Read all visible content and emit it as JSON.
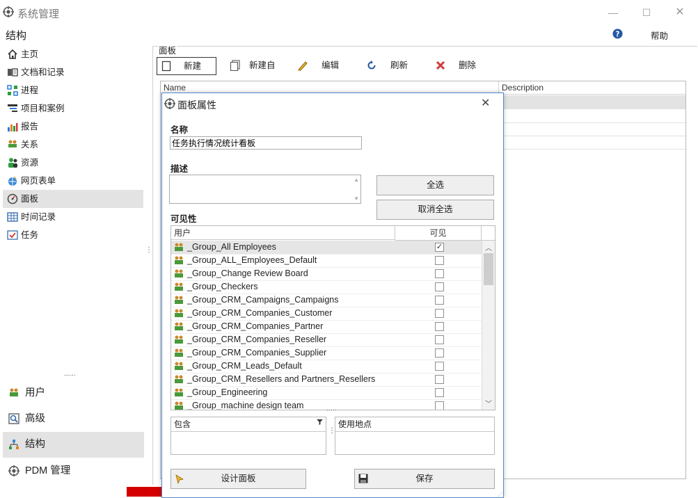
{
  "window": {
    "title": "系统管理",
    "help_label": "帮助"
  },
  "sidebar": {
    "title": "结构",
    "items": [
      {
        "label": "主页",
        "icon": "home-icon"
      },
      {
        "label": "文档和记录",
        "icon": "documents-icon"
      },
      {
        "label": "进程",
        "icon": "process-icon"
      },
      {
        "label": "项目和案例",
        "icon": "projects-icon"
      },
      {
        "label": "报告",
        "icon": "report-chart-icon"
      },
      {
        "label": "关系",
        "icon": "relations-icon"
      },
      {
        "label": "资源",
        "icon": "resources-icon"
      },
      {
        "label": "网页表单",
        "icon": "web-form-icon"
      },
      {
        "label": "面板",
        "icon": "dashboard-icon"
      },
      {
        "label": "时间记录",
        "icon": "time-record-icon"
      },
      {
        "label": "任务",
        "icon": "task-icon"
      }
    ],
    "selected_index": 8,
    "splitter_dots": "......",
    "bottom": [
      {
        "label": "用户",
        "icon": "users-icon"
      },
      {
        "label": "高级",
        "icon": "advanced-icon"
      },
      {
        "label": "结构",
        "icon": "structure-icon"
      },
      {
        "label": "PDM 管理",
        "icon": "pdm-icon"
      }
    ]
  },
  "main": {
    "section_title": "面板",
    "toolbar": [
      {
        "label": "新建",
        "icon": "new-icon"
      },
      {
        "label": "新建自",
        "icon": "copy-icon"
      },
      {
        "label": "编辑",
        "icon": "pencil-icon"
      },
      {
        "label": "刷新",
        "icon": "refresh-icon"
      },
      {
        "label": "删除",
        "icon": "delete-icon"
      }
    ],
    "grid": {
      "columns": [
        "Name",
        "Description"
      ]
    }
  },
  "dialog": {
    "title": "面板属性",
    "name_label": "名称",
    "name_value": "任务执行情况统计看板",
    "description_label": "描述",
    "description_value": "",
    "select_all": "全选",
    "deselect_all": "取消全选",
    "visibility_label": "可见性",
    "columns": [
      "用户",
      "可见"
    ],
    "users": [
      {
        "name": "_Group_All Employees",
        "visible": true
      },
      {
        "name": "_Group_ALL_Employees_Default",
        "visible": false
      },
      {
        "name": "_Group_Change Review Board",
        "visible": false
      },
      {
        "name": "_Group_Checkers",
        "visible": false
      },
      {
        "name": "_Group_CRM_Campaigns_Campaigns",
        "visible": false
      },
      {
        "name": "_Group_CRM_Companies_Customer",
        "visible": false
      },
      {
        "name": "_Group_CRM_Companies_Partner",
        "visible": false
      },
      {
        "name": "_Group_CRM_Companies_Reseller",
        "visible": false
      },
      {
        "name": "_Group_CRM_Companies_Supplier",
        "visible": false
      },
      {
        "name": "_Group_CRM_Leads_Default",
        "visible": false
      },
      {
        "name": "_Group_CRM_Resellers and Partners_Resellers",
        "visible": false
      },
      {
        "name": "_Group_Engineering",
        "visible": false
      },
      {
        "name": "_Group_machine design team",
        "visible": false
      }
    ],
    "contains_label": "包含",
    "used_in_label": "使用地点",
    "design_button": "设计面板",
    "save_button": "保存",
    "check_mark": "✓"
  },
  "colors": {
    "accent_border": "#4f8bd0",
    "selected_bg": "#e3e3e3",
    "red_strip": "#d40000"
  }
}
